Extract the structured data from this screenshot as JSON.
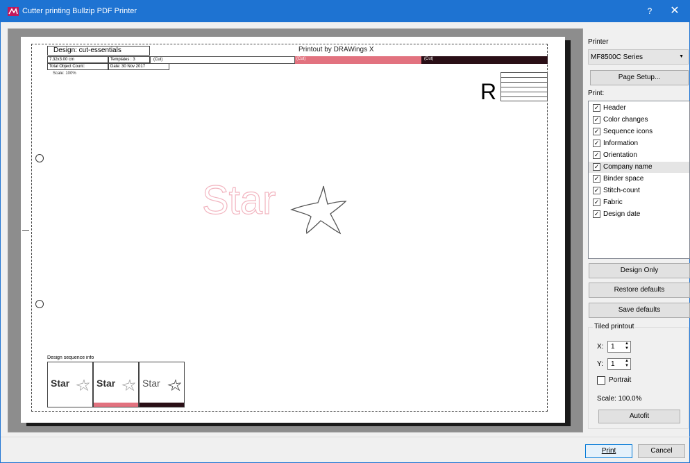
{
  "window": {
    "title": "Cutter printing Bullzip PDF Printer",
    "help": "?",
    "close": "✕"
  },
  "colors": {
    "title_bar": "#1e73d2",
    "pink": "#e2727f",
    "dark_maroon": "#2a0f16",
    "star_outline": "#f2b5c0"
  },
  "preview": {
    "design_name": "Design: cut-essentials",
    "printout_by": "Printout by DRAWings X",
    "size": "7.32x3.00 cm",
    "templates": "Templates : 3",
    "object_count": "Total Object Count:",
    "date": "Date: 30 Nov 2017",
    "scale": "Scale: 100%",
    "cut_labels": [
      "(Cut)",
      "(Cut)",
      "(Cut)"
    ],
    "star_text": "Star",
    "orientation_letter": "R",
    "sequence_title": "Design sequence info",
    "thumb_text": "Star"
  },
  "side": {
    "printer_label": "Printer",
    "printer_value": "MF8500C Series",
    "page_setup": "Page Setup...",
    "print_label": "Print:",
    "options": [
      {
        "label": "Header",
        "checked": true
      },
      {
        "label": "Color changes",
        "checked": true
      },
      {
        "label": "Sequence icons",
        "checked": true
      },
      {
        "label": "Information",
        "checked": true
      },
      {
        "label": "Orientation",
        "checked": true
      },
      {
        "label": "Company name",
        "checked": true
      },
      {
        "label": "Binder space",
        "checked": true
      },
      {
        "label": "Stitch-count",
        "checked": true
      },
      {
        "label": "Fabric",
        "checked": true
      },
      {
        "label": "Design date",
        "checked": true
      }
    ],
    "design_only": "Design Only",
    "restore_defaults": "Restore defaults",
    "save_defaults": "Save defaults",
    "tiled_label": "Tiled printout",
    "x_label": "X:",
    "x_value": "1",
    "y_label": "Y:",
    "y_value": "1",
    "portrait": "Portrait",
    "scale": "Scale: 100.0%",
    "autofit": "Autofit"
  },
  "footer": {
    "print": "Print",
    "cancel": "Cancel"
  }
}
